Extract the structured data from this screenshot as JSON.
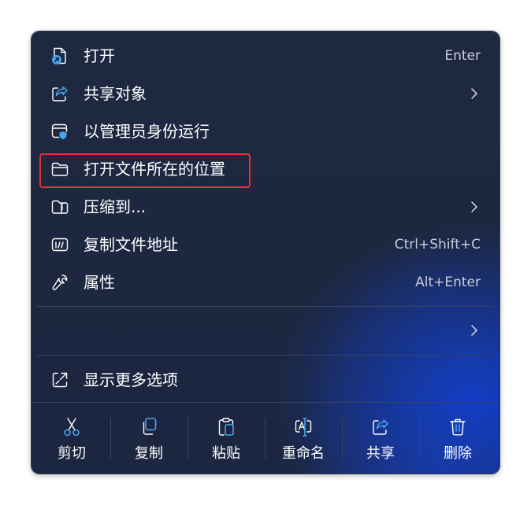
{
  "menu": {
    "items": [
      {
        "label": "打开",
        "shortcut": "Enter",
        "icon": "open-file-icon"
      },
      {
        "label": "共享对象",
        "icon": "share-icon",
        "submenu": true
      },
      {
        "label": "以管理员身份运行",
        "icon": "admin-shield-icon"
      },
      {
        "label": "打开文件所在的位置",
        "icon": "folder-icon"
      },
      {
        "label": "压缩到...",
        "icon": "zip-folder-icon",
        "submenu": true
      },
      {
        "label": "复制文件地址",
        "shortcut": "Ctrl+Shift+C",
        "icon": "path-icon"
      },
      {
        "label": "属性",
        "shortcut": "Alt+Enter",
        "icon": "wrench-icon"
      }
    ],
    "more_options": {
      "label": "显示更多选项",
      "icon": "more-options-icon"
    },
    "highlight_color": "#e63234",
    "accent_color": "#5aa9f5"
  },
  "toolbar": [
    {
      "label": "剪切",
      "icon": "scissors-icon"
    },
    {
      "label": "复制",
      "icon": "copy-icon"
    },
    {
      "label": "粘贴",
      "icon": "paste-icon"
    },
    {
      "label": "重命名",
      "icon": "rename-icon"
    },
    {
      "label": "共享",
      "icon": "share-icon"
    },
    {
      "label": "删除",
      "icon": "trash-icon"
    }
  ]
}
